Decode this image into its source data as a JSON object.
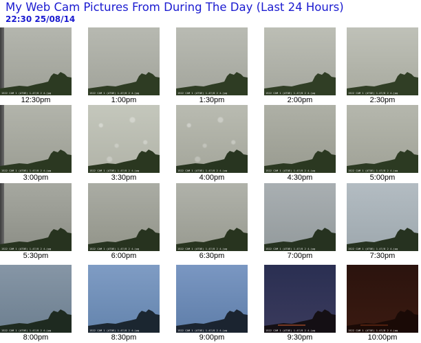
{
  "page": {
    "title": "My Web Cam Pictures From During The Day (Last 24 Hours)",
    "timestamp": "22:30  25/08/14",
    "title_color": "#1a1ad0"
  },
  "thumbnails": [
    {
      "label": "12:30pm",
      "sky": [
        "#b4b6ae",
        "#9ea097"
      ],
      "land": "#2c3a22",
      "rain": false
    },
    {
      "label": "1:00pm",
      "sky": [
        "#b7b9b1",
        "#a1a39a"
      ],
      "land": "#2e3c23",
      "rain": false
    },
    {
      "label": "1:30pm",
      "sky": [
        "#b9bbb3",
        "#a3a59c"
      ],
      "land": "#2e3c23",
      "rain": false
    },
    {
      "label": "2:00pm",
      "sky": [
        "#bcbeb5",
        "#a5a79e"
      ],
      "land": "#303e25",
      "rain": false
    },
    {
      "label": "2:30pm",
      "sky": [
        "#bfc1b8",
        "#a8aa9f"
      ],
      "land": "#303e25",
      "rain": false
    },
    {
      "label": "3:00pm",
      "sky": [
        "#b2b4ab",
        "#9c9e94"
      ],
      "land": "#2b3821",
      "rain": false
    },
    {
      "label": "3:30pm",
      "sky": [
        "#c4c7bc",
        "#b1b3a8"
      ],
      "land": "#2a3720",
      "rain": true
    },
    {
      "label": "4:00pm",
      "sky": [
        "#b9bbb1",
        "#a4a69b"
      ],
      "land": "#283520",
      "rain": true
    },
    {
      "label": "4:30pm",
      "sky": [
        "#aeb0a6",
        "#999b90"
      ],
      "land": "#2b3821",
      "rain": false
    },
    {
      "label": "5:00pm",
      "sky": [
        "#b5b7ad",
        "#a0a297"
      ],
      "land": "#2c3a22",
      "rain": false
    },
    {
      "label": "5:30pm",
      "sky": [
        "#a6a8a0",
        "#8c8e86"
      ],
      "land": "#27331f",
      "rain": false
    },
    {
      "label": "6:00pm",
      "sky": [
        "#aaaca4",
        "#929489"
      ],
      "land": "#27331f",
      "rain": false
    },
    {
      "label": "6:30pm",
      "sky": [
        "#b0b2aa",
        "#989a90"
      ],
      "land": "#28341f",
      "rain": false
    },
    {
      "label": "7:00pm",
      "sky": [
        "#a9afb2",
        "#939a9c"
      ],
      "land": "#263220",
      "rain": false
    },
    {
      "label": "7:30pm",
      "sky": [
        "#b3bcc2",
        "#9ea8ae"
      ],
      "land": "#263220",
      "rain": false
    },
    {
      "label": "8:00pm",
      "sky": [
        "#8696a6",
        "#6d7f90"
      ],
      "land": "#1e2a20",
      "rain": false
    },
    {
      "label": "8:30pm",
      "sky": [
        "#7f9cc4",
        "#6484ad"
      ],
      "land": "#1b2630",
      "rain": false
    },
    {
      "label": "9:00pm",
      "sky": [
        "#7a97c2",
        "#5f7ea9"
      ],
      "land": "#1b2430",
      "rain": false
    },
    {
      "label": "9:30pm",
      "sky": [
        "#2a2f52",
        "#3a3a5c"
      ],
      "land": "#140f14",
      "rain": false
    },
    {
      "label": "10:00pm",
      "sky": [
        "#2b130e",
        "#3a1a10"
      ],
      "land": "#1a0a06",
      "rain": false
    }
  ],
  "thumbnail_stamp": "1522 CAM 1 (ATOE) 1.47/8 2 4.jpg"
}
